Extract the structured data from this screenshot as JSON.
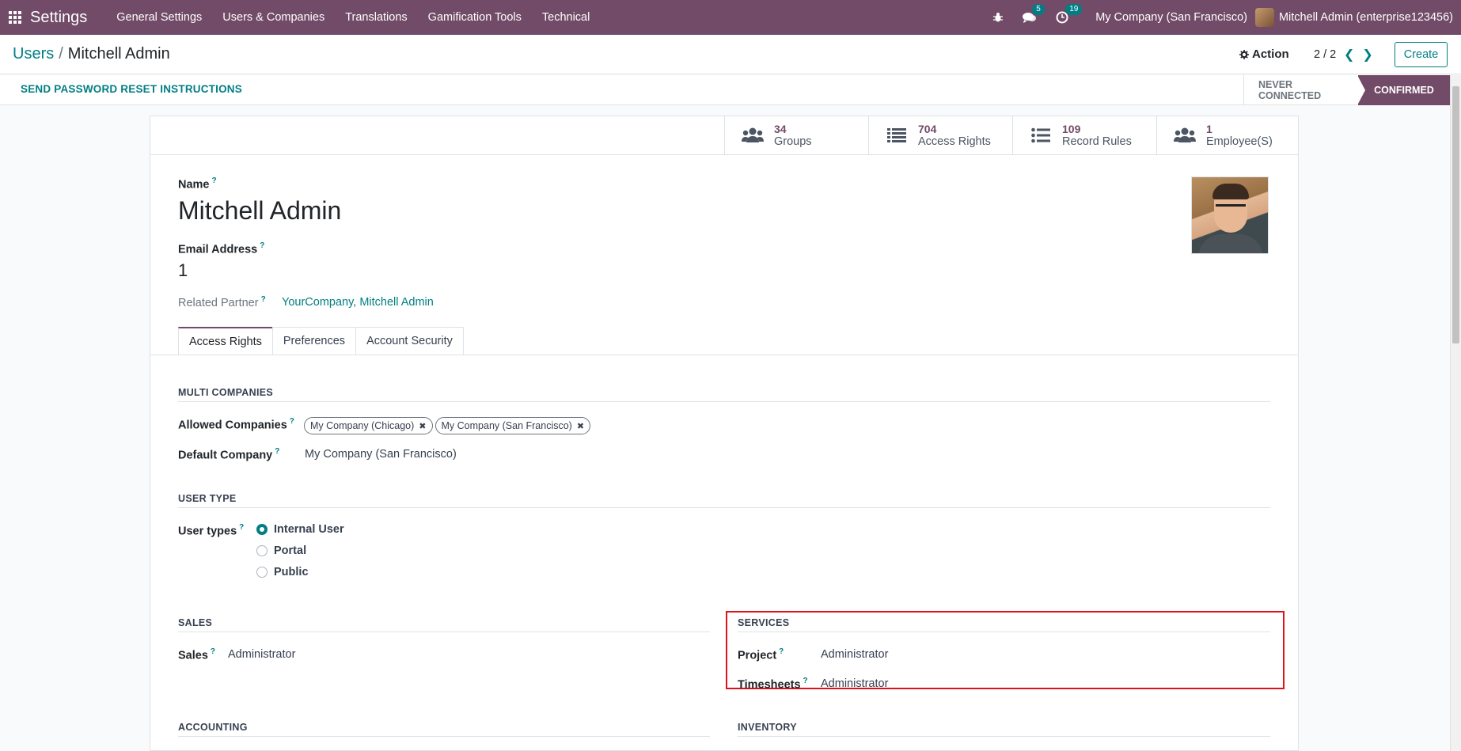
{
  "topbar": {
    "app_name": "Settings",
    "menu": [
      "General Settings",
      "Users & Companies",
      "Translations",
      "Gamification Tools",
      "Technical"
    ],
    "chat_count": "5",
    "activity_count": "19",
    "company": "My Company (San Francisco)",
    "user": "Mitchell Admin (enterprise123456)"
  },
  "control": {
    "breadcrumb_root": "Users",
    "breadcrumb_sep": "/",
    "breadcrumb_current": "Mitchell Admin",
    "action_label": "Action",
    "pager": "2 / 2",
    "create_label": "Create"
  },
  "statusbar": {
    "reset_label": "SEND PASSWORD RESET INSTRUCTIONS",
    "stages": [
      "NEVER CONNECTED",
      "CONFIRMED"
    ],
    "active_stage": "CONFIRMED"
  },
  "smart_buttons": [
    {
      "value": "34",
      "label": "Groups",
      "icon": "users-icon"
    },
    {
      "value": "704",
      "label": "Access Rights",
      "icon": "list-icon"
    },
    {
      "value": "109",
      "label": "Record Rules",
      "icon": "list-icon"
    },
    {
      "value": "1",
      "label": "Employee(S)",
      "icon": "users-icon"
    }
  ],
  "form": {
    "help_mark": "?",
    "name_label": "Name",
    "name_value": "Mitchell Admin",
    "email_label": "Email Address",
    "email_value": "1",
    "partner_label": "Related Partner",
    "partner_value": "YourCompany, Mitchell Admin"
  },
  "tabs": [
    "Access Rights",
    "Preferences",
    "Account Security"
  ],
  "access": {
    "multi_companies_title": "MULTI COMPANIES",
    "allowed_label": "Allowed Companies",
    "allowed_tags": [
      "My Company (Chicago)",
      "My Company (San Francisco)"
    ],
    "default_label": "Default Company",
    "default_value": "My Company (San Francisco)",
    "user_type_title": "USER TYPE",
    "user_types_label": "User types",
    "user_types": [
      "Internal User",
      "Portal",
      "Public"
    ],
    "user_type_selected": "Internal User",
    "sales_title": "SALES",
    "sales_label": "Sales",
    "sales_value": "Administrator",
    "services_title": "SERVICES",
    "project_label": "Project",
    "project_value": "Administrator",
    "timesheets_label": "Timesheets",
    "timesheets_value": "Administrator",
    "accounting_title": "ACCOUNTING",
    "inventory_title": "INVENTORY"
  },
  "colors": {
    "brand": "#714b67",
    "accent": "#017e84",
    "highlight": "#e0101c"
  }
}
